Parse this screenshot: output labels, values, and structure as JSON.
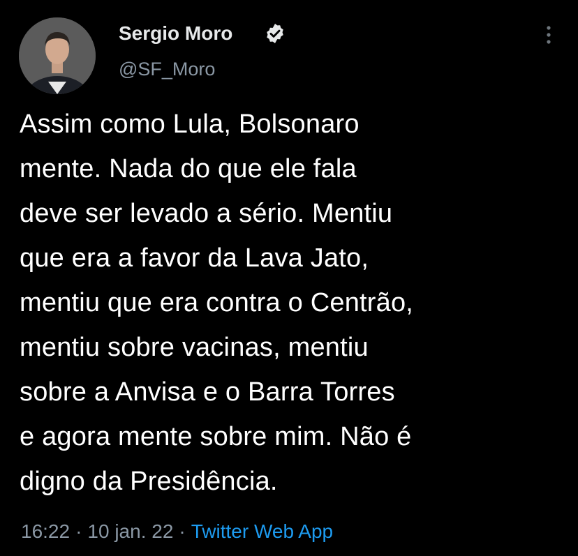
{
  "tweet": {
    "author": {
      "display_name": "Sergio Moro",
      "handle": "@SF_Moro",
      "verified": true,
      "avatar": "profile-photo"
    },
    "text": "Assim como Lula, Bolsonaro\nmente. Nada do que ele fala\ndeve ser levado a sério. Mentiu\nque era a favor da Lava Jato,\nmentiu que era contra o Centrão,\nmentiu sobre vacinas, mentiu\nsobre a Anvisa e o Barra Torres\ne agora mente sobre mim. Não é\ndigno da Presidência.",
    "time": "16:22",
    "date": "10 jan. 22",
    "separator": "·",
    "source": "Twitter Web App"
  },
  "icons": {
    "verified": "verified-badge-icon",
    "more": "more-options-icon"
  },
  "colors": {
    "background": "#000000",
    "text": "#ffffff",
    "secondary": "#8b98a5",
    "link": "#1d9bf0"
  }
}
